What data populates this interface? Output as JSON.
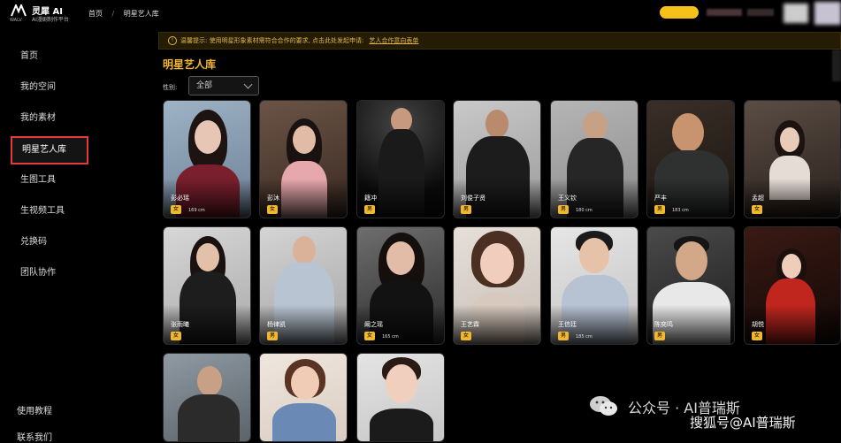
{
  "header": {
    "logo_mark": "WALV",
    "brand_name": "灵犀 AI",
    "brand_tagline": "AI漫剧制作平台",
    "breadcrumb": [
      "首页",
      "明星艺人库"
    ],
    "breadcrumb_sep": "/"
  },
  "sidebar": {
    "items": [
      {
        "label": "首页"
      },
      {
        "label": "我的空间"
      },
      {
        "label": "我的素材"
      },
      {
        "label": "明星艺人库"
      },
      {
        "label": "生图工具"
      },
      {
        "label": "生视频工具"
      },
      {
        "label": "兑换码"
      },
      {
        "label": "团队协作"
      }
    ],
    "bottom": [
      {
        "label": "使用教程"
      },
      {
        "label": "联系我们"
      }
    ]
  },
  "notice": {
    "text": "温馨提示: 使用明星形象素材需符合合作的要求, 点击此处发起申请:",
    "link": "艺人合作意向表单"
  },
  "section_title": "明星艺人库",
  "filter": {
    "label": "性别:",
    "selected": "全部"
  },
  "artists": [
    {
      "name": "彭必瑶",
      "gender": "女",
      "height": "169 cm"
    },
    {
      "name": "彭沐",
      "gender": "女",
      "height": ""
    },
    {
      "name": "籍冲",
      "gender": "男",
      "height": ""
    },
    {
      "name": "刘俊子贤",
      "gender": "男",
      "height": ""
    },
    {
      "name": "王义钦",
      "gender": "男",
      "height": "180 cm"
    },
    {
      "name": "严丰",
      "gender": "男",
      "height": "183 cm"
    },
    {
      "name": "孟超",
      "gender": "女",
      "height": ""
    },
    {
      "name": "张雨曦",
      "gender": "女",
      "height": ""
    },
    {
      "name": "杨律凯",
      "gender": "男",
      "height": ""
    },
    {
      "name": "阚之瑶",
      "gender": "女",
      "height": "165 cm"
    },
    {
      "name": "王艺霖",
      "gender": "女",
      "height": ""
    },
    {
      "name": "王信廷",
      "gender": "男",
      "height": "185 cm"
    },
    {
      "name": "陈奕鸣",
      "gender": "男",
      "height": ""
    },
    {
      "name": "胡悦",
      "gender": "女",
      "height": ""
    },
    {
      "name": "",
      "gender": "",
      "height": ""
    },
    {
      "name": "",
      "gender": "",
      "height": ""
    },
    {
      "name": "",
      "gender": "",
      "height": ""
    }
  ],
  "watermark": {
    "line1": "公众号 · AI普瑞斯",
    "line2": "搜狐号@AI普瑞斯"
  },
  "colors": {
    "accent": "#f1b72e",
    "active_border": "#e13b3b",
    "notice_bg": "#241c04"
  }
}
